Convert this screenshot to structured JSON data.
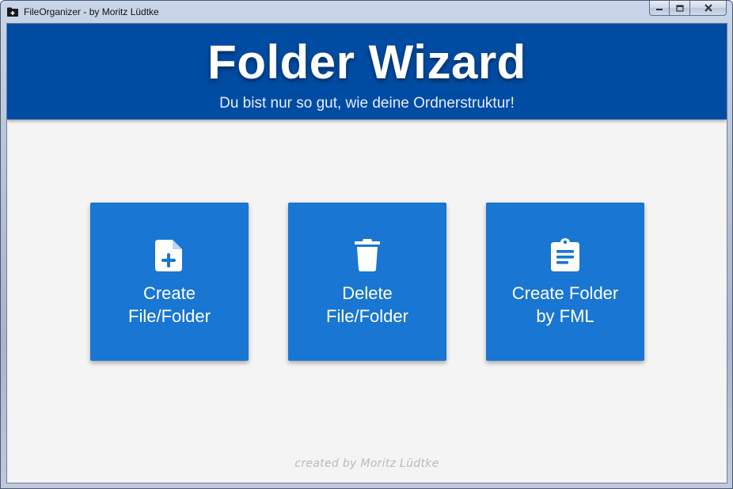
{
  "window": {
    "title": "FileOrganizer - by Moritz Lüdtke"
  },
  "header": {
    "title": "Folder Wizard",
    "subtitle": "Du bist nur so gut, wie deine Ordnerstruktur!"
  },
  "tiles": [
    {
      "label": "Create\nFile/Folder",
      "icon": "file-plus-icon"
    },
    {
      "label": "Delete\nFile/Folder",
      "icon": "trash-icon"
    },
    {
      "label": "Create Folder\nby FML",
      "icon": "clipboard-list-icon"
    }
  ],
  "footer": {
    "credit": "created by Moritz Lüdtke"
  },
  "colors": {
    "header": "#004ca3",
    "tile": "#1976d2",
    "background": "#f4f4f4"
  }
}
